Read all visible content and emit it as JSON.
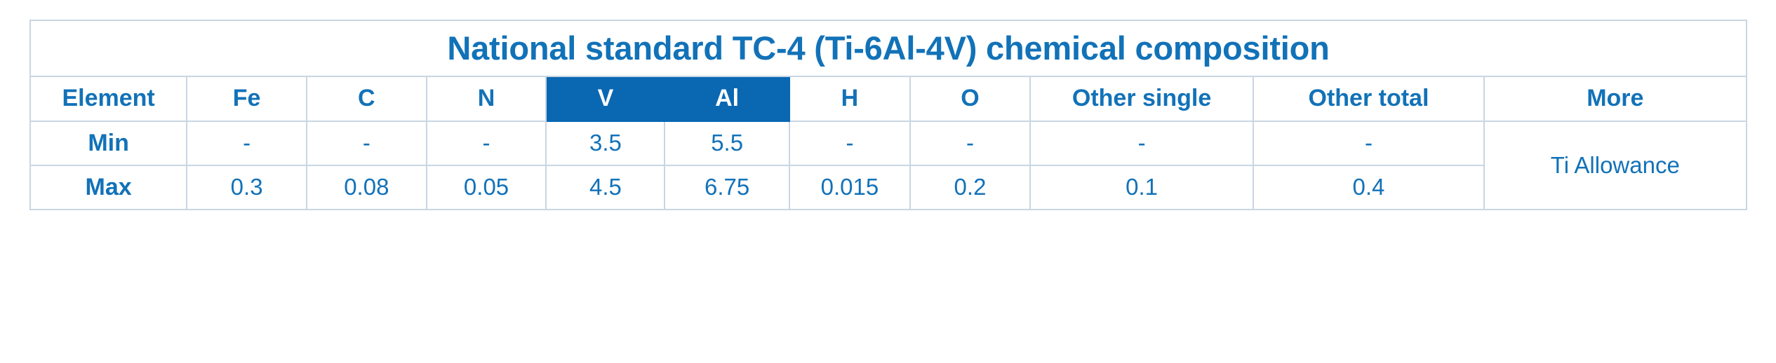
{
  "table": {
    "title": "National standard TC-4 (Ti-6Al-4V) chemical composition",
    "columns": [
      {
        "key": "element",
        "label": "Element",
        "highlight": false
      },
      {
        "key": "fe",
        "label": "Fe",
        "highlight": false
      },
      {
        "key": "c",
        "label": "C",
        "highlight": false
      },
      {
        "key": "n",
        "label": "N",
        "highlight": false
      },
      {
        "key": "v",
        "label": "V",
        "highlight": true
      },
      {
        "key": "al",
        "label": "Al",
        "highlight": true
      },
      {
        "key": "h",
        "label": "H",
        "highlight": false
      },
      {
        "key": "o",
        "label": "O",
        "highlight": false
      },
      {
        "key": "other_single",
        "label": "Other single",
        "highlight": false
      },
      {
        "key": "other_total",
        "label": "Other total",
        "highlight": false
      },
      {
        "key": "more",
        "label": "More",
        "highlight": false
      }
    ],
    "rows": [
      {
        "label": "Min",
        "fe": "-",
        "c": "-",
        "n": "-",
        "v": "3.5",
        "al": "5.5",
        "h": "-",
        "o": "-",
        "other_single": "-",
        "other_total": "-"
      },
      {
        "label": "Max",
        "fe": "0.3",
        "c": "0.08",
        "n": "0.05",
        "v": "4.5",
        "al": "6.75",
        "h": "0.015",
        "o": "0.2",
        "other_single": "0.1",
        "other_total": "0.4"
      }
    ],
    "more_value": "Ti Allowance",
    "colors": {
      "text_blue": "#1272b8",
      "highlight_bg": "#0a68b3",
      "highlight_text": "#ffffff",
      "border": "#c9d6e2"
    }
  }
}
